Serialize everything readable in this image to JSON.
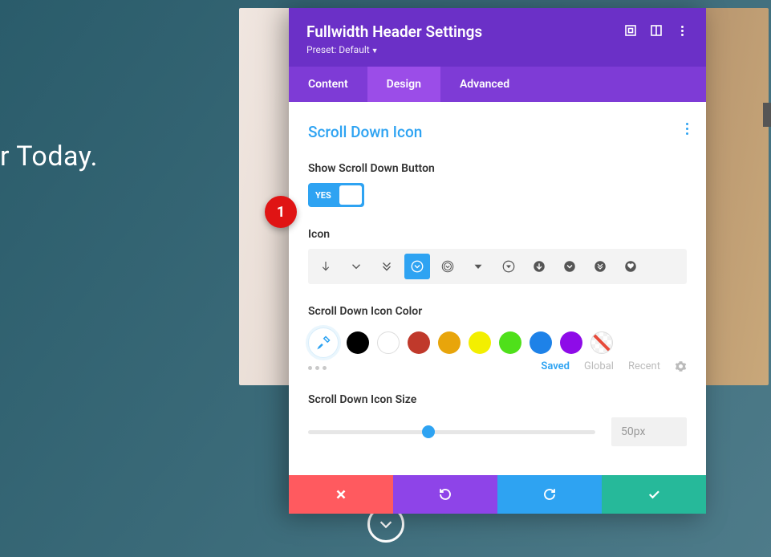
{
  "hero": {
    "text": "r Today."
  },
  "panel": {
    "title": "Fullwidth Header Settings",
    "preset_label": "Preset: ",
    "preset_value": "Default",
    "tabs": {
      "content": "Content",
      "design": "Design",
      "advanced": "Advanced",
      "active": "design"
    }
  },
  "section": {
    "title": "Scroll Down Icon",
    "show_label": "Show Scroll Down Button",
    "toggle_value": "YES",
    "icon_label": "Icon",
    "icon_options": [
      "arrow-down",
      "chevron-down",
      "double-chevron",
      "circle-chevron-filled",
      "circle-chevron-outline",
      "caret-down",
      "circle-caret-outline",
      "circle-arrow-down-dark",
      "circle-chevron-dark",
      "circle-double-chevron-dark",
      "heart-circle-dark"
    ],
    "icon_selected_index": 3,
    "color_label": "Scroll Down Icon Color",
    "colors": [
      "#000000",
      "#ffffff",
      "#c0392b",
      "#e8a50b",
      "#f3ef00",
      "#4fe01a",
      "#1e82e8",
      "#8e0be8",
      "nocolor"
    ],
    "color_tabs": {
      "saved": "Saved",
      "global": "Global",
      "recent": "Recent",
      "active": "saved"
    },
    "size_label": "Scroll Down Icon Size",
    "size_value": "50px",
    "slider_percent": 42
  },
  "marker": {
    "label": "1"
  }
}
